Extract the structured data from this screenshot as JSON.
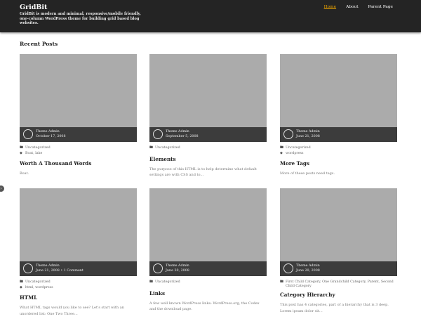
{
  "site": {
    "title": "GridBit",
    "description": "GridBit is modern and minimal, responsive/mobile friendly, one-column WordPress theme for building grid based blog websites."
  },
  "nav": {
    "items": [
      "Home",
      "About",
      "Parent Page"
    ],
    "active": "Home"
  },
  "section_title": "Recent Posts",
  "icons": {
    "category": "folder-icon",
    "tag": "tag-icon",
    "toggle": "chevron-right-icon"
  },
  "colors": {
    "header_bg": "#242424",
    "active_nav": "#e8a100",
    "thumb_bg": "#ababab",
    "meta_bar": "#3c3c3c"
  },
  "posts": [
    {
      "author": "Theme Admin",
      "date": "October 17, 2008",
      "category": "Uncategorized",
      "tags": "Boat, lake",
      "title": "Worth A Thousand Words",
      "excerpt": "Boat."
    },
    {
      "author": "Theme Admin",
      "date": "September 5, 2008",
      "category": "Uncategorized",
      "tags": "",
      "title": "Elements",
      "excerpt": "The purpose of this HTML is to help determine what default settings are with CSS and to..."
    },
    {
      "author": "Theme Admin",
      "date": "June 21, 2008",
      "category": "Uncategorized",
      "tags": "wordpress",
      "title": "More Tags",
      "excerpt": "More of these posts need tags."
    },
    {
      "author": "Theme Admin",
      "date": "June 21, 2008 • 1 Comment",
      "category": "Uncategorized",
      "tags": "html, wordpress",
      "title": "HTML",
      "excerpt": "What HTML tags would you like to see? Let's start with an unordered list: One Two Three..."
    },
    {
      "author": "Theme Admin",
      "date": "June 20, 2008",
      "category": "Uncategorized",
      "tags": "",
      "title": "Links",
      "excerpt": "A few well known WordPress links: WordPress.org, the Codex and the download page."
    },
    {
      "author": "Theme Admin",
      "date": "June 20, 2008",
      "category": "First Child Category, One Grandchild Category, Parent, Second Child Category",
      "tags": "",
      "title": "Category Hierarchy",
      "excerpt": "This post has 4 categories, part of a hierarchy that is 3 deep. Lorem ipsum dolor sit..."
    }
  ]
}
